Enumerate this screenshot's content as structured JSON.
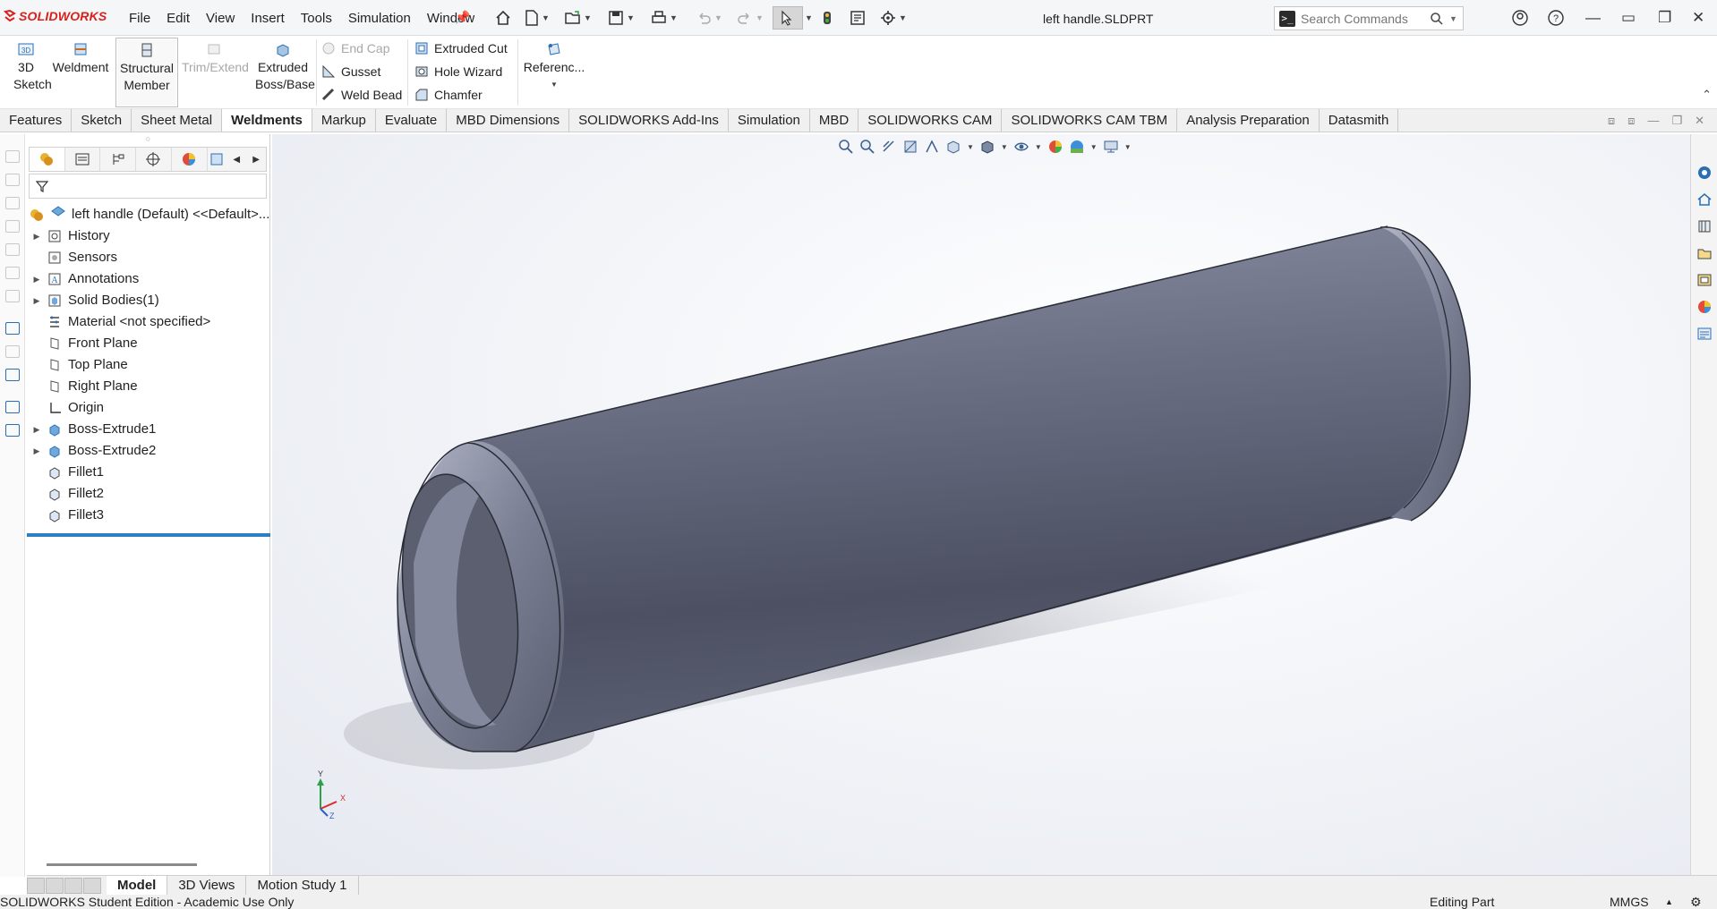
{
  "app": {
    "name": "SOLIDWORKS",
    "doc_title": "left handle.SLDPRT"
  },
  "menu": [
    "File",
    "Edit",
    "View",
    "Insert",
    "Tools",
    "Simulation",
    "Window"
  ],
  "search": {
    "placeholder": "Search Commands"
  },
  "commands": {
    "sketch3d": "3D Sketch",
    "weldment": "Weldment",
    "structural_member": "Structural Member",
    "trim_extend": "Trim/Extend",
    "extruded_boss": "Extruded Boss/Base",
    "end_cap": "End Cap",
    "gusset": "Gusset",
    "weld_bead": "Weld Bead",
    "extruded_cut": "Extruded Cut",
    "hole_wizard": "Hole Wizard",
    "chamfer": "Chamfer",
    "reference": "Referenc..."
  },
  "tabs": [
    "Features",
    "Sketch",
    "Sheet Metal",
    "Weldments",
    "Markup",
    "Evaluate",
    "MBD Dimensions",
    "SOLIDWORKS Add-Ins",
    "Simulation",
    "MBD",
    "SOLIDWORKS CAM",
    "SOLIDWORKS CAM TBM",
    "Analysis Preparation",
    "Datasmith"
  ],
  "active_tab": "Weldments",
  "tree": {
    "root": "left handle (Default) <<Default>...",
    "items": [
      "History",
      "Sensors",
      "Annotations",
      "Solid Bodies(1)",
      "Material <not specified>",
      "Front Plane",
      "Top Plane",
      "Right Plane",
      "Origin",
      "Boss-Extrude1",
      "Boss-Extrude2",
      "Fillet1",
      "Fillet2",
      "Fillet3"
    ]
  },
  "triad": {
    "x": "X",
    "y": "Y",
    "z": "Z"
  },
  "bottom_tabs": [
    "Model",
    "3D Views",
    "Motion Study 1"
  ],
  "status": {
    "edition": "SOLIDWORKS Student Edition - Academic Use Only",
    "mode": "Editing Part",
    "units": "MMGS"
  }
}
